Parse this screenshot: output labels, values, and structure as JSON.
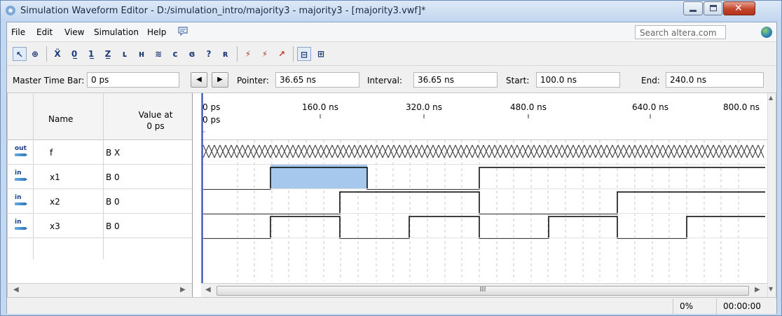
{
  "window": {
    "title": "Simulation Waveform Editor - D:/simulation_intro/majority3 - majority3 - [majority3.vwf]*"
  },
  "menu": {
    "items": [
      "File",
      "Edit",
      "View",
      "Simulation",
      "Help"
    ],
    "search_placeholder": "Search altera.com"
  },
  "timebar": {
    "master_label": "Master Time Bar:",
    "master_value": "0 ps",
    "pointer_label": "Pointer:",
    "pointer_value": "36.65 ns",
    "interval_label": "Interval:",
    "interval_value": "36.65 ns",
    "start_label": "Start:",
    "start_value": "100.0 ns",
    "end_label": "End:",
    "end_value": "240.0 ns"
  },
  "table": {
    "col_name": "Name",
    "col_value_line1": "Value at",
    "col_value_line2": "0 ps",
    "rows": [
      {
        "dir": "out",
        "name": "f",
        "value": "B X"
      },
      {
        "dir": "in",
        "name": "x1",
        "value": "B 0"
      },
      {
        "dir": "in",
        "name": "x2",
        "value": "B 0"
      },
      {
        "dir": "in",
        "name": "x3",
        "value": "B 0"
      }
    ]
  },
  "timeline": {
    "ticks": [
      "0 ps",
      "160.0 ns",
      "320.0 ns",
      "480.0 ns",
      "640.0 ns",
      "800.0 ns"
    ],
    "cursor_label": "0 ps",
    "scroll_marker": "III"
  },
  "status": {
    "progress": "0%",
    "elapsed": "00:00:00"
  },
  "colors": {
    "title_bg": "#c4d9f0",
    "selection": "#a6c8ec",
    "cursor": "#1a3fb0"
  }
}
